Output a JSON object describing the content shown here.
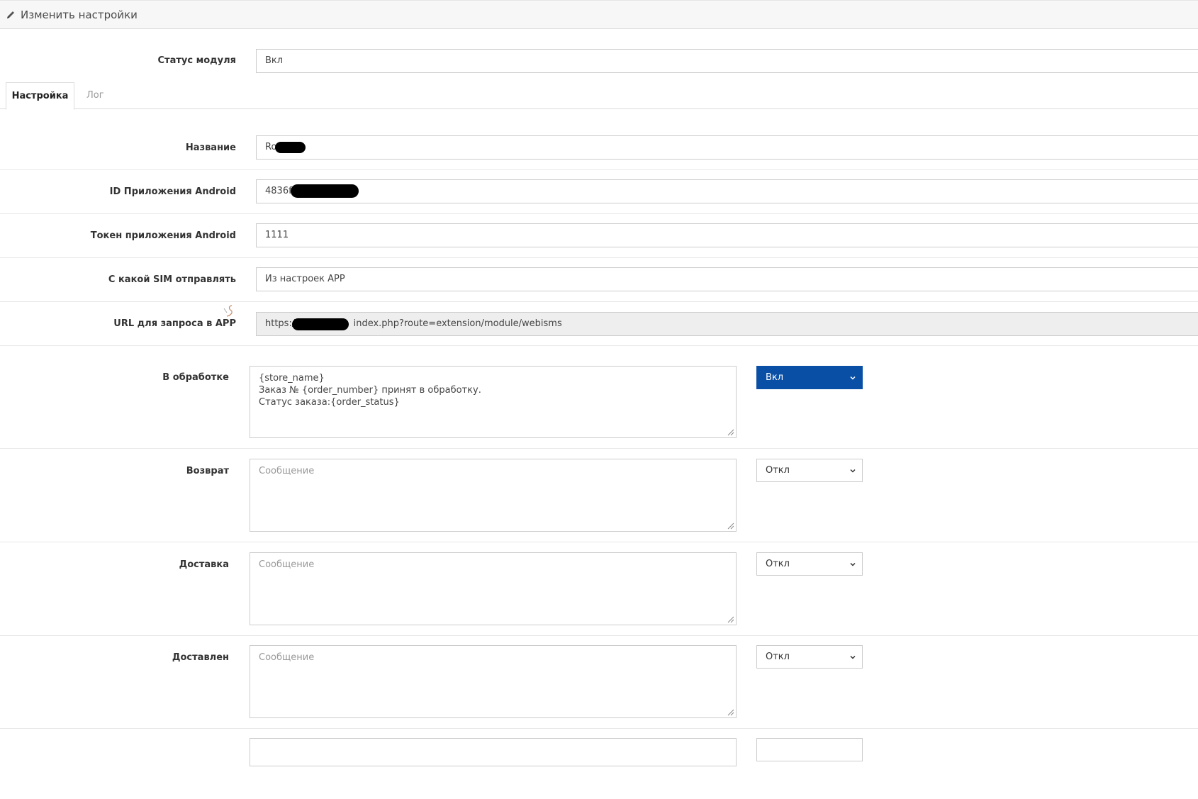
{
  "header": {
    "title": "Изменить настройки",
    "icon": "pencil-icon"
  },
  "module_status": {
    "label": "Статус модуля",
    "value": "Вкл"
  },
  "tabs": [
    {
      "label": "Настройка",
      "active": true
    },
    {
      "label": "Лог",
      "active": false
    }
  ],
  "fields": {
    "name": {
      "label": "Название",
      "value": "Ro"
    },
    "android_id": {
      "label": "ID Приложения Android",
      "value": "4836f3"
    },
    "android_token": {
      "label": "Токен приложения Android",
      "value": "1111"
    },
    "sim": {
      "label": "С какой SIM отправлять",
      "value": "Из настроек APP"
    },
    "url": {
      "label": "URL для запроса в APP",
      "value_prefix": "https://",
      "value_suffix": "index.php?route=extension/module/webisms"
    }
  },
  "statuses": [
    {
      "label": "В обработке",
      "message": "{store_name}\nЗаказ № {order_number} принят в обработку.\nСтатус заказа:{order_status}",
      "placeholder": "Сообщение",
      "toggle": "Вкл",
      "enabled": true
    },
    {
      "label": "Возврат",
      "message": "",
      "placeholder": "Сообщение",
      "toggle": "Откл",
      "enabled": false
    },
    {
      "label": "Доставка",
      "message": "",
      "placeholder": "Сообщение",
      "toggle": "Откл",
      "enabled": false
    },
    {
      "label": "Доставлен",
      "message": "",
      "placeholder": "Сообщение",
      "toggle": "Откл",
      "enabled": false
    }
  ],
  "colors": {
    "primary": "#0a4fa6",
    "border": "#cccccc",
    "readonly_bg": "#eeeeee"
  }
}
